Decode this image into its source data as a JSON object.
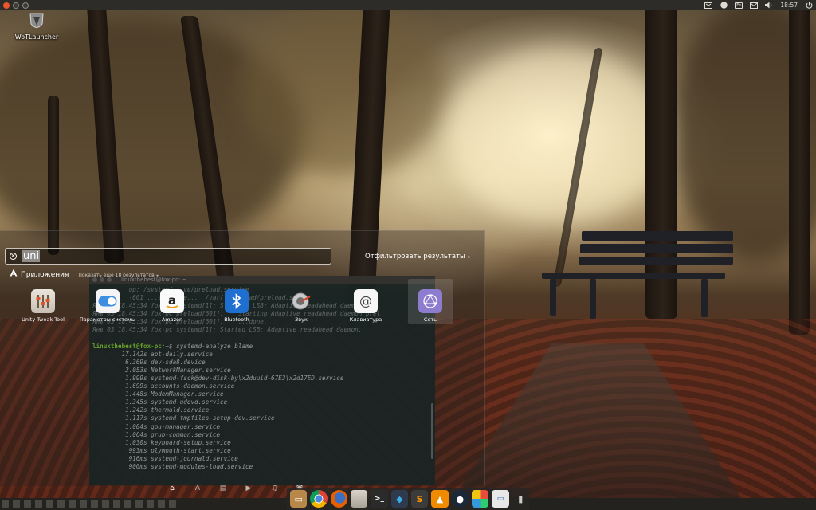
{
  "top_panel": {
    "keyboard_layout": "En",
    "clock": "18:57",
    "tray_icons": [
      "dropbox-icon",
      "network-icon",
      "keyboard-icon",
      "mail-icon",
      "volume-icon",
      "power-icon"
    ]
  },
  "desktop": {
    "icon_label": "WoTLauncher"
  },
  "dash": {
    "search_value": "uni",
    "filter_label": "Отфильтровать результаты",
    "category_title": "Приложения",
    "category_more": "Показать ещё 18 результатов",
    "apps": [
      {
        "label": "Unity Tweak Tool",
        "icon": "unity-tweak-tool-icon"
      },
      {
        "label": "Параметры системы",
        "icon": "system-settings-icon"
      },
      {
        "label": "Amazon",
        "icon": "amazon-icon"
      },
      {
        "label": "Bluetooth",
        "icon": "bluetooth-icon"
      },
      {
        "label": "Звук",
        "icon": "sound-icon"
      },
      {
        "label": "Клавиатура",
        "icon": "keyboard-icon"
      },
      {
        "label": "Сеть",
        "icon": "network-icon"
      }
    ],
    "lenses": [
      "home-lens-icon",
      "applications-lens-icon",
      "files-lens-icon",
      "video-lens-icon",
      "music-lens-icon",
      "photos-lens-icon"
    ]
  },
  "terminal": {
    "title": "linuxthebest@fox-pc: ~",
    "lines": [
      "          up: /system/...ve/preload.service",
      "          -601 ...sbin/pre...  /var/lib/...ad/preload.state",
      "Янв 03 18:45:34 fox-pc systemd[1]: Starting LSB: Adaptive readahead daemon...",
      "Янв 03 18:45:34 fox-pc preload[601]:  * Starting Adaptive readahead daemon prel",
      "Янв 03 18:45:34 fox-pc preload[601]:    ...done.",
      "Янв 03 18:45:34 fox-pc systemd[1]: Started LSB: Adaptive readahead daemon."
    ],
    "prompt": "linuxthebest@fox-pc",
    "command": ":~$ systemd-analyze blame",
    "blame": [
      "        17.142s apt-daily.service",
      "         6.369s dev-sda8.device",
      "         2.053s NetworkManager.service",
      "         1.999s systemd-fsck@dev-disk-by\\x2duuid-67E3\\x2d17ED.service",
      "         1.699s accounts-daemon.service",
      "         1.448s ModemManager.service",
      "         1.345s systemd-udevd.service",
      "         1.242s thermald.service",
      "         1.117s systemd-tmpfiles-setup-dev.service",
      "         1.084s gpu-manager.service",
      "         1.064s grub-common.service",
      "         1.030s keyboard-setup.service",
      "          993ms plymouth-start.service",
      "          916ms systemd-journald.service",
      "          900ms systemd-modules-load.service"
    ]
  },
  "dock": {
    "items": [
      "files-icon",
      "chrome-icon",
      "firefox-icon",
      "disks-icon",
      "terminal-icon",
      "kodi-icon",
      "sublime-icon",
      "vlc-icon",
      "steam-icon",
      "solitaire-icon",
      "remote-desktop-icon",
      "trash-icon"
    ]
  }
}
